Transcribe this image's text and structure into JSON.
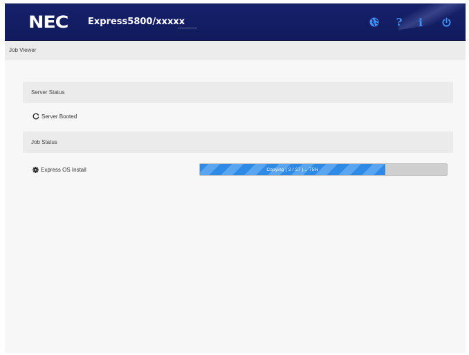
{
  "header": {
    "brand": "NEC",
    "product": "Express5800/xxxxx",
    "icons": [
      "globe-icon",
      "help-icon",
      "info-icon",
      "power-icon"
    ],
    "help_glyph": "?",
    "info_glyph": "i",
    "icon_color": "#3d8ff0",
    "background_color": "#14206a"
  },
  "breadcrumb": {
    "label": "Job Viewer"
  },
  "server_status": {
    "heading": "Server Status",
    "item_label": "Server Booted",
    "item_icon": "refresh-icon"
  },
  "job_status": {
    "heading": "Job Status",
    "item_label": "Express OS Install",
    "item_icon": "gear-icon",
    "progress_text": "Copying ( 2 / 27 )... 75%",
    "progress_percent": 75,
    "progress_color": "#2f8ae6"
  }
}
